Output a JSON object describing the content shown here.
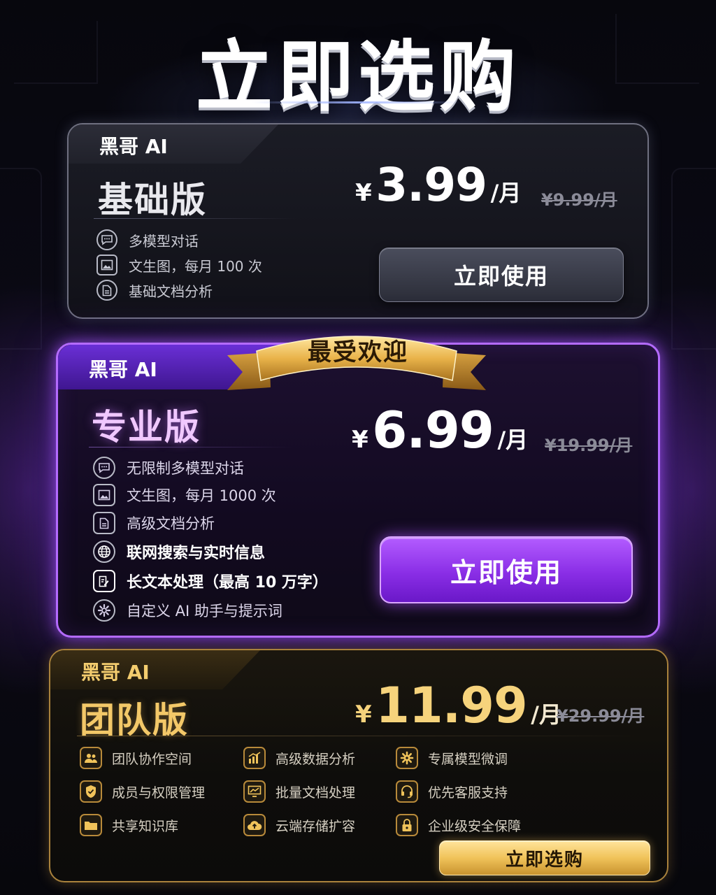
{
  "header": {
    "title": "立即选购"
  },
  "plans": [
    {
      "brand": "黑哥 AI",
      "name": "基础版",
      "currency": "¥",
      "price": "3.99",
      "per": "/月",
      "old_price": "¥9.99/月",
      "features": [
        {
          "icon": "chat-bubble-icon",
          "label": "多模型对话"
        },
        {
          "icon": "image-icon",
          "label": "文生图，每月 100 次"
        },
        {
          "icon": "document-icon",
          "label": "基础文档分析"
        }
      ],
      "cta": "立即使用"
    },
    {
      "brand": "黑哥 AI",
      "name": "专业版",
      "badge": "最受欢迎",
      "currency": "¥",
      "price": "6.99",
      "per": "/月",
      "old_price": "¥19.99/月",
      "features": [
        {
          "icon": "chat-bubble-icon",
          "label": "无限制多模型对话"
        },
        {
          "icon": "image-icon",
          "label": "文生图，每月 1000 次"
        },
        {
          "icon": "document-icon",
          "label": "高级文档分析"
        },
        {
          "icon": "globe-icon",
          "label": "联网搜索与实时信息"
        },
        {
          "icon": "edit-document-icon",
          "label": "长文本处理（最高 10 万字）"
        },
        {
          "icon": "gear-icon",
          "label": "自定义 AI 助手与提示词"
        }
      ],
      "cta": "立即使用"
    },
    {
      "brand": "黑哥 AI",
      "name": "团队版",
      "currency": "¥",
      "price": "11.99",
      "per": "/月",
      "old_price": "¥29.99/月",
      "features": [
        {
          "icon": "team-icon",
          "label": "团队协作空间"
        },
        {
          "icon": "shield-icon",
          "label": "成员与权限管理"
        },
        {
          "icon": "folder-icon",
          "label": "共享知识库"
        },
        {
          "icon": "bar-chart-icon",
          "label": "高级数据分析"
        },
        {
          "icon": "monitor-chart-icon",
          "label": "批量文档处理"
        },
        {
          "icon": "cloud-upload-icon",
          "label": "云端存储扩容"
        },
        {
          "icon": "gear-icon",
          "label": "专属模型微调"
        },
        {
          "icon": "headset-icon",
          "label": "优先客服支持"
        },
        {
          "icon": "lock-icon",
          "label": "企业级安全保障"
        }
      ],
      "cta": "立即选购"
    }
  ],
  "colors": {
    "purple_accent": "#b46bff",
    "gold_accent": "#f0c35a",
    "basic_border": "#6f7080"
  }
}
